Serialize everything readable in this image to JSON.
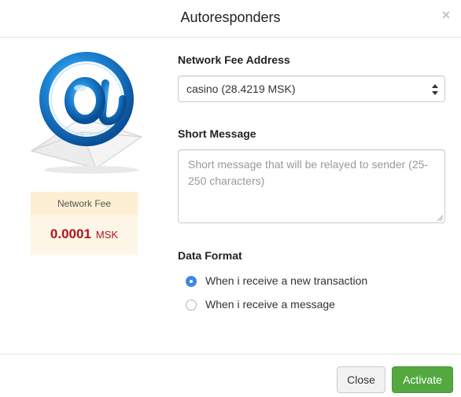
{
  "dialog": {
    "title": "Autoresponders"
  },
  "fee": {
    "label": "Network Fee",
    "amount": "0.0001",
    "unit": "MSK"
  },
  "form": {
    "address_label": "Network Fee Address",
    "address_value": "casino (28.4219 MSK)",
    "message_label": "Short Message",
    "message_placeholder": "Short message that will be relayed to sender (25-250 characters)",
    "format_label": "Data Format",
    "format_options": [
      {
        "label": "When i receive a new transaction",
        "selected": true
      },
      {
        "label": "When i receive a message",
        "selected": false
      }
    ]
  },
  "footer": {
    "close_label": "Close",
    "activate_label": "Activate"
  },
  "colors": {
    "accent_blue": "#3d87e6",
    "fee_red": "#b0151e",
    "activate_green": "#53a93f"
  }
}
